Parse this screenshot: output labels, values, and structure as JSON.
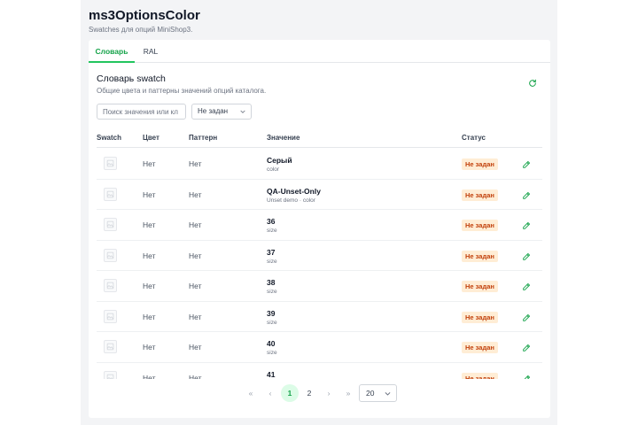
{
  "header": {
    "title": "ms3OptionsColor",
    "subtitle": "Swatches для опций MiniShop3."
  },
  "tabs": [
    {
      "label": "Словарь",
      "active": true
    },
    {
      "label": "RAL",
      "active": false
    }
  ],
  "section": {
    "title": "Словарь swatch",
    "description": "Общие цвета и паттерны значений опций каталога."
  },
  "filters": {
    "search_placeholder": "Поиск значения или кл",
    "status_value": "Не задан"
  },
  "table": {
    "headers": {
      "swatch": "Swatch",
      "color": "Цвет",
      "pattern": "Паттерн",
      "value": "Значение",
      "status": "Статус"
    },
    "rows": [
      {
        "color": "Нет",
        "pattern": "Нет",
        "value": "Серый",
        "sub": "color",
        "status": "Не задан"
      },
      {
        "color": "Нет",
        "pattern": "Нет",
        "value": "QA-Unset-Only",
        "sub": "Unset demo · color",
        "status": "Не задан"
      },
      {
        "color": "Нет",
        "pattern": "Нет",
        "value": "36",
        "sub": "size",
        "status": "Не задан"
      },
      {
        "color": "Нет",
        "pattern": "Нет",
        "value": "37",
        "sub": "size",
        "status": "Не задан"
      },
      {
        "color": "Нет",
        "pattern": "Нет",
        "value": "38",
        "sub": "size",
        "status": "Не задан"
      },
      {
        "color": "Нет",
        "pattern": "Нет",
        "value": "39",
        "sub": "size",
        "status": "Не задан"
      },
      {
        "color": "Нет",
        "pattern": "Нет",
        "value": "40",
        "sub": "size",
        "status": "Не задан"
      },
      {
        "color": "Нет",
        "pattern": "Нет",
        "value": "41",
        "sub": "",
        "status": "Не задан"
      }
    ]
  },
  "pagination": {
    "first": "«",
    "prev": "‹",
    "pages": [
      "1",
      "2"
    ],
    "current": "1",
    "next": "›",
    "last": "»",
    "per_page": "20"
  },
  "colors": {
    "accent": "#16a34a",
    "badge_text": "#c2410c",
    "badge_bg": "#ffedd5",
    "page_bg": "#f3f4f6"
  },
  "icons": {
    "refresh": "refresh-icon",
    "edit": "pencil-icon",
    "dropdown": "chevron-down-icon",
    "swatch": "image-placeholder-icon"
  }
}
